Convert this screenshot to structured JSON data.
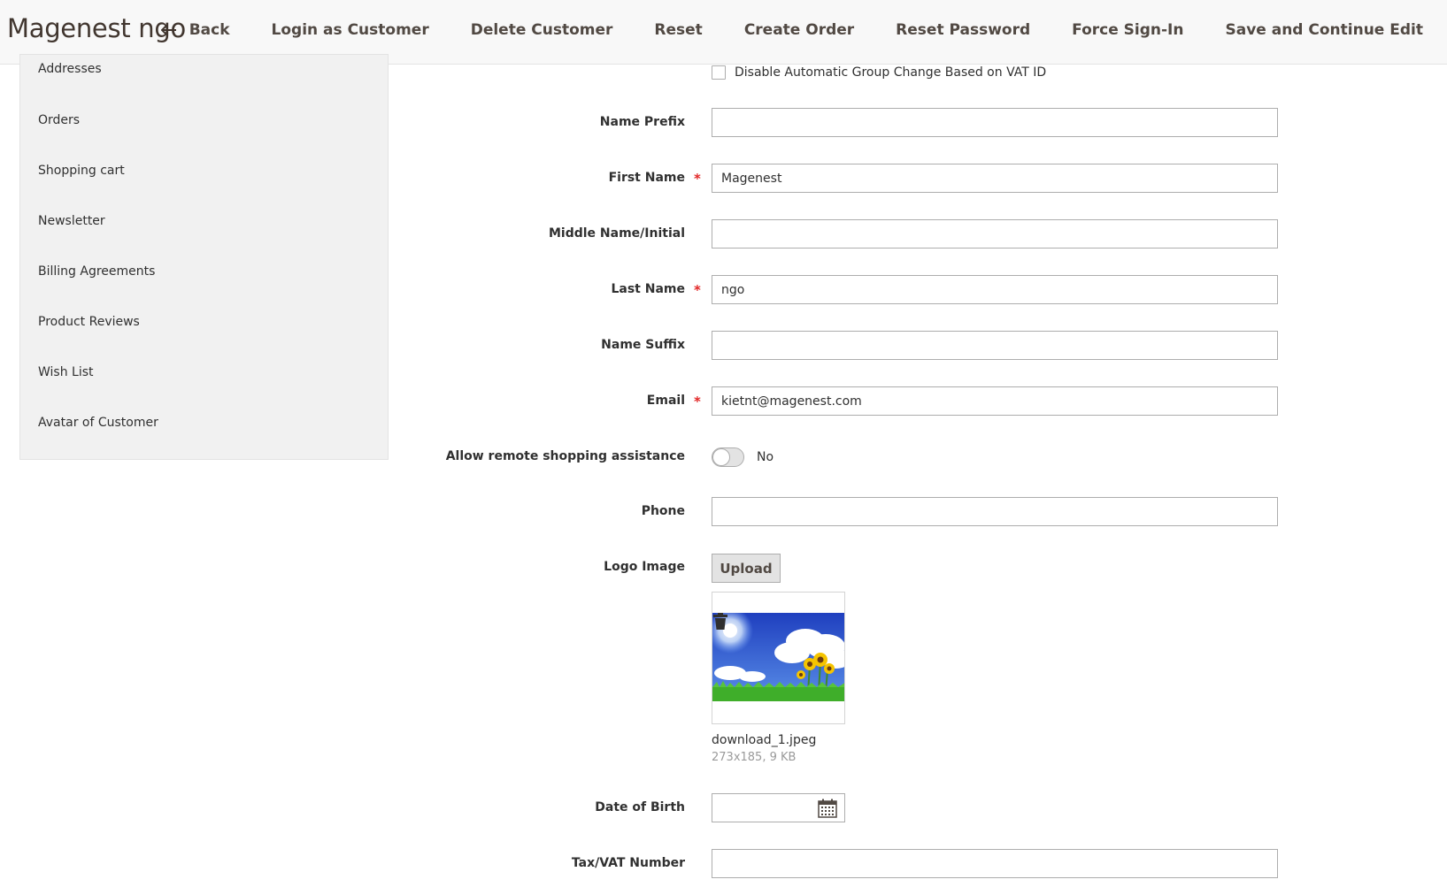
{
  "header": {
    "title": "Magenest ngo",
    "actions": {
      "back": "Back",
      "login_as_customer": "Login as Customer",
      "delete_customer": "Delete Customer",
      "reset": "Reset",
      "create_order": "Create Order",
      "reset_password": "Reset Password",
      "force_sign_in": "Force Sign-In",
      "save_continue": "Save and Continue Edit"
    }
  },
  "sidebar": {
    "items": [
      {
        "label": "Addresses"
      },
      {
        "label": "Orders"
      },
      {
        "label": "Shopping cart"
      },
      {
        "label": "Newsletter"
      },
      {
        "label": "Billing Agreements"
      },
      {
        "label": "Product Reviews"
      },
      {
        "label": "Wish List"
      },
      {
        "label": "Avatar of Customer"
      }
    ]
  },
  "form": {
    "disable_group_change": {
      "label": "Disable Automatic Group Change Based on VAT ID",
      "checked": false
    },
    "name_prefix": {
      "label": "Name Prefix",
      "value": ""
    },
    "first_name": {
      "label": "First Name",
      "value": "Magenest",
      "required": "*"
    },
    "middle_name": {
      "label": "Middle Name/Initial",
      "value": ""
    },
    "last_name": {
      "label": "Last Name",
      "value": "ngo",
      "required": "*"
    },
    "name_suffix": {
      "label": "Name Suffix",
      "value": ""
    },
    "email": {
      "label": "Email",
      "value": "kietnt@magenest.com",
      "required": "*"
    },
    "remote_assistance": {
      "label": "Allow remote shopping assistance",
      "state": "No"
    },
    "phone": {
      "label": "Phone",
      "value": ""
    },
    "logo_image": {
      "label": "Logo Image",
      "upload_label": "Upload",
      "file_name": "download_1.jpeg",
      "file_meta": "273x185, 9 KB"
    },
    "date_of_birth": {
      "label": "Date of Birth",
      "value": ""
    },
    "tax_vat": {
      "label": "Tax/VAT Number",
      "value": ""
    }
  },
  "colors": {
    "header_bg": "#f8f8f8",
    "sidebar_bg": "#f1f1f1",
    "required_star": "#e22626",
    "button_text": "#514943"
  },
  "icons": [
    "back-arrow-icon",
    "trash-icon",
    "calendar-icon"
  ]
}
